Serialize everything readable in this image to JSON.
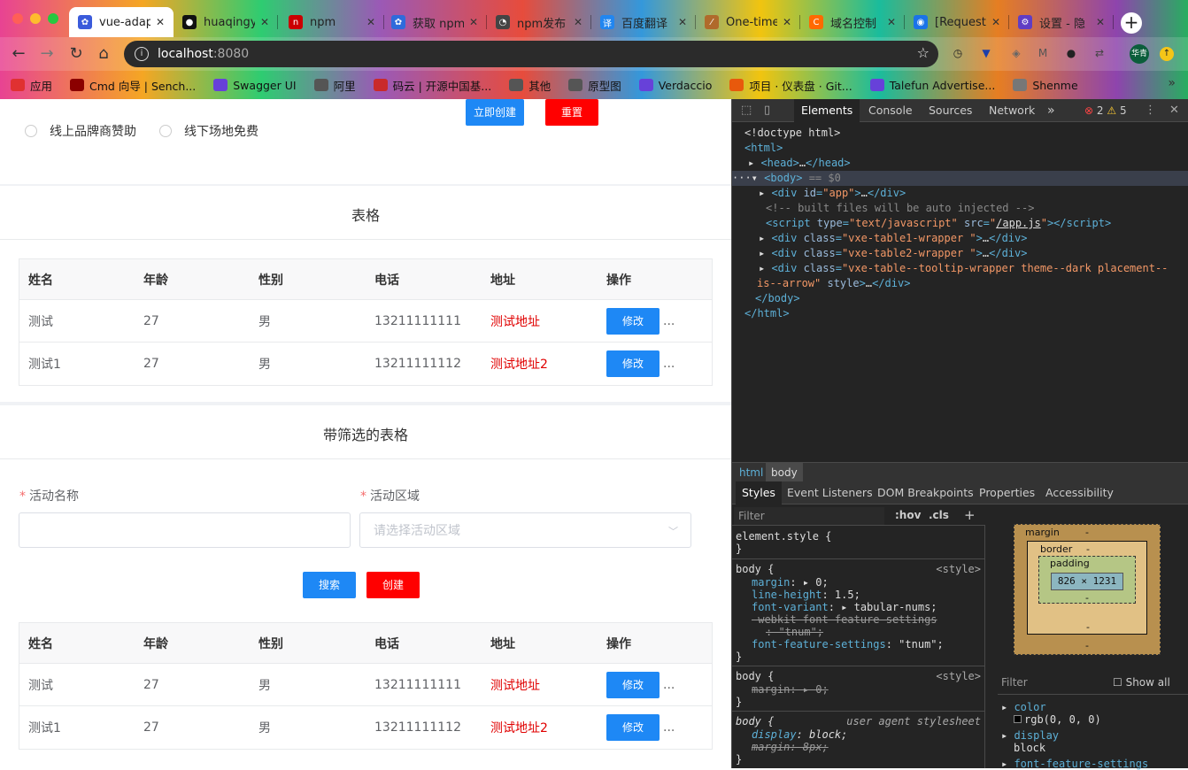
{
  "browser": {
    "tabs": [
      {
        "title": "vue-adap",
        "fav_color": "#3b5bdb",
        "fav_glyph": "✿",
        "active": true
      },
      {
        "title": "huaqingy",
        "fav_color": "#111111",
        "fav_glyph": "●"
      },
      {
        "title": "npm",
        "fav_color": "#cb0000",
        "fav_glyph": "n"
      },
      {
        "title": "获取 npm",
        "fav_color": "#2f6bdb",
        "fav_glyph": "✿"
      },
      {
        "title": "npm发布",
        "fav_color": "#444444",
        "fav_glyph": "◔"
      },
      {
        "title": "百度翻译",
        "fav_color": "#2186f0",
        "fav_glyph": "译"
      },
      {
        "title": "One-time",
        "fav_color": "#b06a2b",
        "fav_glyph": "⁄"
      },
      {
        "title": "域名控制",
        "fav_color": "#ff6a00",
        "fav_glyph": "C"
      },
      {
        "title": "[Request",
        "fav_color": "#1a73e8",
        "fav_glyph": "◉"
      },
      {
        "title": "设置 - 隐",
        "fav_color": "#5f3dc4",
        "fav_glyph": "⚙"
      }
    ],
    "new_tab": "+",
    "url_host": "localhost",
    "url_port": ":8080",
    "bookmarks": [
      {
        "label": "应用",
        "color": "#e03131"
      },
      {
        "label": "Cmd 向导 | Sench...",
        "color": "#8b0000"
      },
      {
        "label": "Swagger UI",
        "color": "#6741d9"
      },
      {
        "label": "阿里",
        "color": "#555555"
      },
      {
        "label": "码云 | 开源中国基...",
        "color": "#c92a2a"
      },
      {
        "label": "其他",
        "color": "#555555"
      },
      {
        "label": "原型图",
        "color": "#555555"
      },
      {
        "label": "Verdaccio",
        "color": "#6741d9"
      },
      {
        "label": "项目 · 仪表盘 · Git...",
        "color": "#e8590c"
      },
      {
        "label": "Talefun Advertise...",
        "color": "#6741d9"
      },
      {
        "label": "Shenme",
        "color": "#777777"
      }
    ],
    "avatar": "华青"
  },
  "page": {
    "top_card": {
      "radio_1": "线上品牌商赞助",
      "radio_2": "线下场地免费",
      "create_btn": "立即创建",
      "reset_btn": "重置"
    },
    "table1": {
      "title": "表格",
      "headers": [
        "姓名",
        "年龄",
        "性别",
        "电话",
        "地址",
        "操作"
      ],
      "rows": [
        [
          "测试",
          "27",
          "男",
          "13211111111",
          "测试地址"
        ],
        [
          "测试1",
          "27",
          "男",
          "13211111112",
          "测试地址2"
        ]
      ],
      "action": "修改",
      "more": "..."
    },
    "table2": {
      "title": "带筛选的表格",
      "field1_label": "活动名称",
      "field2_label": "活动区域",
      "field2_placeholder": "请选择活动区域",
      "required_mark": "*",
      "search_btn": "搜索",
      "create_btn": "创建",
      "headers": [
        "姓名",
        "年龄",
        "性别",
        "电话",
        "地址",
        "操作"
      ],
      "rows": [
        [
          "测试",
          "27",
          "男",
          "13211111111",
          "测试地址"
        ],
        [
          "测试1",
          "27",
          "男",
          "13211111112",
          "测试地址2"
        ]
      ],
      "action": "修改",
      "more": "..."
    }
  },
  "devtools": {
    "tabs": [
      "Elements",
      "Console",
      "Sources",
      "Network"
    ],
    "more_tabs": "»",
    "errors": "2",
    "warnings": "5",
    "crumbs": [
      "html",
      "body"
    ],
    "style_tabs": [
      "Styles",
      "Event Listeners",
      "DOM Breakpoints",
      "Properties",
      "Accessibility"
    ],
    "filter_placeholder": "Filter",
    "hov": ":hov",
    "cls": ".cls",
    "box_content": "826 × 1231",
    "box_labels": {
      "margin": "margin",
      "border": "border",
      "padding": "padding",
      "dash": "-"
    },
    "computed_filter": "Filter",
    "show_all": "Show all"
  }
}
